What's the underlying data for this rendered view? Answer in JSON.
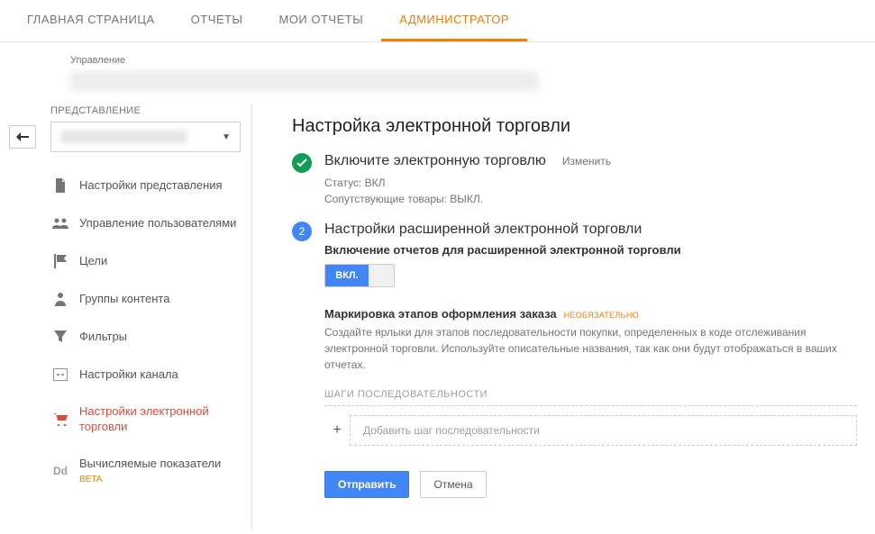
{
  "nav": {
    "items": [
      {
        "label": "ГЛАВНАЯ СТРАНИЦА"
      },
      {
        "label": "ОТЧЕТЫ"
      },
      {
        "label": "МОИ ОТЧЕТЫ"
      },
      {
        "label": "АДМИНИСТРАТОР"
      }
    ]
  },
  "crumb": {
    "label": "Управление"
  },
  "sidebar": {
    "section_label": "ПРЕДСТАВЛЕНИЕ",
    "items": [
      {
        "label": "Настройки представления"
      },
      {
        "label": "Управление пользователями"
      },
      {
        "label": "Цели"
      },
      {
        "label": "Группы контента"
      },
      {
        "label": "Фильтры"
      },
      {
        "label": "Настройки канала"
      },
      {
        "label": "Настройки электронной торговли"
      },
      {
        "label": "Вычисляемые показатели",
        "beta": "BETA"
      }
    ]
  },
  "content": {
    "title": "Настройка электронной торговли",
    "step1": {
      "title": "Включите электронную торговлю",
      "edit": "Изменить",
      "status1": "Статус: ВКЛ",
      "status2": "Сопутствующие товары: ВЫКЛ."
    },
    "step2": {
      "badge": "2",
      "title": "Настройки расширенной электронной торговли",
      "subheading": "Включение отчетов для расширенной электронной торговли",
      "toggle_on": "ВКЛ.",
      "labeling_title": "Маркировка этапов оформления заказа",
      "optional": "НЕОБЯЗАТЕЛЬНО",
      "labeling_desc": "Создайте ярлыки для этапов последовательности покупки, определенных в коде отслеживания электронной торговли. Используйте описательные названия, так как они будут отображаться в ваших отчетах.",
      "steps_label": "ШАГИ ПОСЛЕДОВАТЕЛЬНОСТИ",
      "add_step": "Добавить шаг последовательности"
    },
    "buttons": {
      "submit": "Отправить",
      "cancel": "Отмена"
    }
  }
}
